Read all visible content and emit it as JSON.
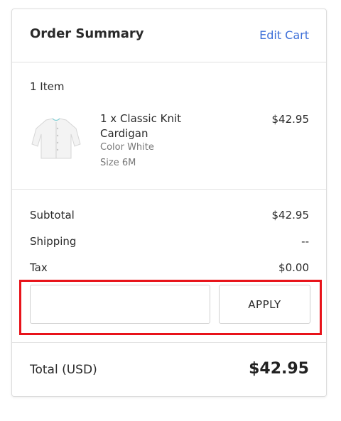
{
  "order_summary": {
    "title": "Order Summary",
    "edit_cart_label": "Edit Cart"
  },
  "items": {
    "count_label": "1 Item",
    "list": [
      {
        "name": "1 x Classic Knit Cardigan",
        "color": "Color White",
        "size": "Size 6M",
        "price": "$42.95",
        "thumbnail_icon": "cardigan-thumbnail"
      }
    ]
  },
  "totals": {
    "subtotal_label": "Subtotal",
    "subtotal_value": "$42.95",
    "shipping_label": "Shipping",
    "shipping_value": "--",
    "tax_label": "Tax",
    "tax_value": "$0.00",
    "total_label": "Total (USD)",
    "total_value": "$42.95"
  },
  "promo": {
    "input_value": "",
    "apply_label": "APPLY",
    "highlight_color": "#e8131a"
  },
  "colors": {
    "link": "#3d6fd8",
    "border": "#e2e2e2",
    "text": "#2a2a2a",
    "muted": "#777777"
  }
}
